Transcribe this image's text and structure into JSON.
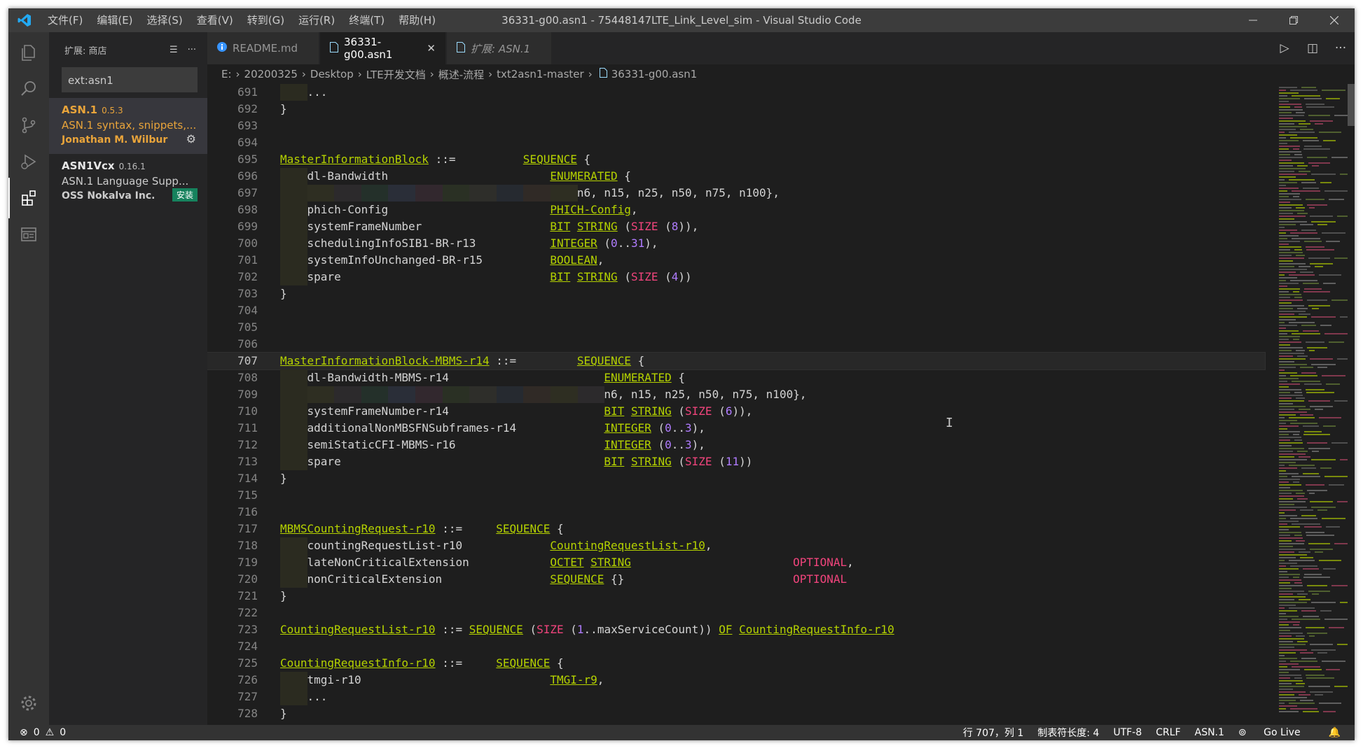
{
  "titlebar": {
    "menu": [
      "文件(F)",
      "编辑(E)",
      "选择(S)",
      "查看(V)",
      "转到(G)",
      "运行(R)",
      "终端(T)",
      "帮助(H)"
    ],
    "title": "36331-g00.asn1 - 75448147LTE_Link_Level_sim - Visual Studio Code"
  },
  "sidebar": {
    "title": "扩展: 商店",
    "search_value": "ext:asn1",
    "extensions": [
      {
        "name": "ASN.1",
        "version": "0.5.3",
        "description": "ASN.1 syntax, snippets,...",
        "publisher": "Jonathan M. Wilbur"
      },
      {
        "name": "ASN1Vcx",
        "version": "0.16.1",
        "description": "ASN.1 Language Supp...",
        "publisher": "OSS Nokalva Inc.",
        "badge": "安装"
      }
    ]
  },
  "tabs": [
    {
      "label": "README.md",
      "icon": "info-icon"
    },
    {
      "label": "36331-g00.asn1",
      "icon": "file-icon",
      "active": true
    },
    {
      "label": "扩展: ASN.1",
      "icon": "file-icon",
      "italic": true
    }
  ],
  "breadcrumb": [
    "E:",
    "20200325",
    "Desktop",
    "LTE开发文档",
    "概述-流程",
    "txt2asn1-master",
    "36331-g00.asn1"
  ],
  "editor": {
    "lines": [
      {
        "n": "691",
        "text": "    ..."
      },
      {
        "n": "692",
        "text": "}"
      },
      {
        "n": "693",
        "text": ""
      },
      {
        "n": "694",
        "text": ""
      },
      {
        "n": "695",
        "text": "MasterInformationBlock ::=          SEQUENCE {"
      },
      {
        "n": "696",
        "text": "    dl-Bandwidth                        ENUMERATED {"
      },
      {
        "n": "697",
        "text": "                                            n6, n15, n25, n50, n75, n100},"
      },
      {
        "n": "698",
        "text": "    phich-Config                        PHICH-Config,"
      },
      {
        "n": "699",
        "text": "    systemFrameNumber                   BIT STRING (SIZE (8)),"
      },
      {
        "n": "700",
        "text": "    schedulingInfoSIB1-BR-r13           INTEGER (0..31),"
      },
      {
        "n": "701",
        "text": "    systemInfoUnchanged-BR-r15          BOOLEAN,"
      },
      {
        "n": "702",
        "text": "    spare                               BIT STRING (SIZE (4))"
      },
      {
        "n": "703",
        "text": "}"
      },
      {
        "n": "704",
        "text": ""
      },
      {
        "n": "705",
        "text": ""
      },
      {
        "n": "706",
        "text": ""
      },
      {
        "n": "707",
        "text": "MasterInformationBlock-MBMS-r14 ::=         SEQUENCE {"
      },
      {
        "n": "708",
        "text": "    dl-Bandwidth-MBMS-r14                       ENUMERATED {"
      },
      {
        "n": "709",
        "text": "                                                n6, n15, n25, n50, n75, n100},"
      },
      {
        "n": "710",
        "text": "    systemFrameNumber-r14                       BIT STRING (SIZE (6)),"
      },
      {
        "n": "711",
        "text": "    additionalNonMBSFNSubframes-r14             INTEGER (0..3),"
      },
      {
        "n": "712",
        "text": "    semiStaticCFI-MBMS-r16                      INTEGER (0..3),"
      },
      {
        "n": "713",
        "text": "    spare                                       BIT STRING (SIZE (11))"
      },
      {
        "n": "714",
        "text": "}"
      },
      {
        "n": "715",
        "text": ""
      },
      {
        "n": "716",
        "text": ""
      },
      {
        "n": "717",
        "text": "MBMSCountingRequest-r10 ::=     SEQUENCE {"
      },
      {
        "n": "718",
        "text": "    countingRequestList-r10             CountingRequestList-r10,"
      },
      {
        "n": "719",
        "text": "    lateNonCriticalExtension            OCTET STRING                        OPTIONAL,"
      },
      {
        "n": "720",
        "text": "    nonCriticalExtension                SEQUENCE {}                         OPTIONAL"
      },
      {
        "n": "721",
        "text": "}"
      },
      {
        "n": "722",
        "text": ""
      },
      {
        "n": "723",
        "text": "CountingRequestList-r10 ::= SEQUENCE (SIZE (1..maxServiceCount)) OF CountingRequestInfo-r10"
      },
      {
        "n": "724",
        "text": ""
      },
      {
        "n": "725",
        "text": "CountingRequestInfo-r10 ::=     SEQUENCE {"
      },
      {
        "n": "726",
        "text": "    tmgi-r10                            TMGI-r9,"
      },
      {
        "n": "727",
        "text": "    ..."
      },
      {
        "n": "728",
        "text": "}"
      }
    ],
    "current_line": "707"
  },
  "statusbar": {
    "errors": "0",
    "warnings": "0",
    "position": "行 707，列 1",
    "tab_size": "制表符长度: 4",
    "encoding": "UTF-8",
    "eol": "CRLF",
    "language": "ASN.1",
    "golive": "Go Live"
  },
  "colors": {
    "accent": "#007acc",
    "keyword": "#b5d200",
    "size_keyword": "#f0447c",
    "number": "#b07cff",
    "selected_extension": "#e9a43a"
  }
}
